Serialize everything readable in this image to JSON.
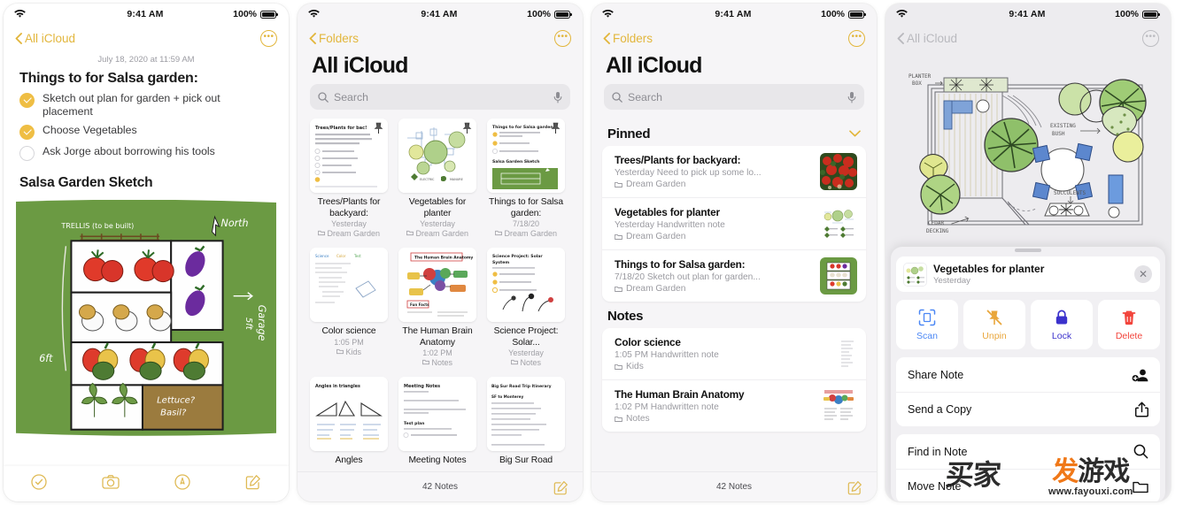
{
  "statusbar": {
    "time": "9:41 AM",
    "battery": "100%",
    "wifi_icon": "wifi-icon"
  },
  "panel1": {
    "nav": {
      "back_label": "All iCloud",
      "more_icon": "more-circle-icon"
    },
    "date": "July 18, 2020 at 11:59 AM",
    "heading": "Things to for Salsa garden:",
    "checklist": [
      {
        "checked": true,
        "text": "Sketch out plan for garden + pick out placement"
      },
      {
        "checked": true,
        "text": "Choose Vegetables"
      },
      {
        "checked": false,
        "text": "Ask Jorge about borrowing his tools"
      }
    ],
    "subheading": "Salsa Garden Sketch",
    "sketch": {
      "trellis_label": "TRELLIS (to be built)",
      "north_label": "North",
      "height_label": "6ft",
      "garage_label": "Garage",
      "garage_dir": "5ft",
      "herb_label_1": "Lettuce?",
      "herb_label_2": "Basil?"
    },
    "toolbar": [
      {
        "name": "checklist-tool",
        "icon": "check-circle-icon"
      },
      {
        "name": "camera-tool",
        "icon": "camera-icon"
      },
      {
        "name": "markup-tool",
        "icon": "markup-pen-icon"
      },
      {
        "name": "compose-tool",
        "icon": "compose-icon"
      }
    ]
  },
  "panel2": {
    "nav": {
      "back_label": "Folders",
      "more_icon": "more-circle-icon"
    },
    "title": "All iCloud",
    "search": {
      "placeholder": "Search",
      "search_icon": "search-icon",
      "mic_icon": "microphone-icon"
    },
    "cards": [
      {
        "title": "Trees/Plants for backyard:",
        "time": "Yesterday",
        "folder": "Dream Garden",
        "pinned": true,
        "thumb": "trees-checklist-thumb",
        "thumb_title": "Trees/Plants for bac!"
      },
      {
        "title": "Vegetables for planter",
        "time": "Yesterday",
        "folder": "Dream Garden",
        "pinned": true,
        "thumb": "planter-sketch-thumb",
        "thumb_title": ""
      },
      {
        "title": "Things to for Salsa garden:",
        "time": "7/18/20",
        "folder": "Dream Garden",
        "pinned": true,
        "thumb": "salsa-garden-thumb",
        "thumb_title": "Things to for Salsa garden:"
      },
      {
        "title": "Color science",
        "time": "1:05 PM",
        "folder": "Kids",
        "pinned": false,
        "thumb": "color-science-thumb",
        "thumb_title": ""
      },
      {
        "title": "The Human Brain Anatomy",
        "time": "1:02 PM",
        "folder": "Notes",
        "pinned": false,
        "thumb": "brain-anatomy-thumb",
        "thumb_title": "The Human Brain Anatomy"
      },
      {
        "title": "Science Project: Solar...",
        "time": "Yesterday",
        "folder": "Notes",
        "pinned": false,
        "thumb": "solar-system-thumb",
        "thumb_title": "Science Project: Solar System"
      },
      {
        "title": "Angles",
        "time": "",
        "folder": "",
        "pinned": false,
        "thumb": "angles-thumb",
        "thumb_title": "Angles in triangles"
      },
      {
        "title": "Meeting Notes",
        "time": "",
        "folder": "",
        "pinned": false,
        "thumb": "meeting-notes-thumb",
        "thumb_title": "Meeting Notes"
      },
      {
        "title": "Big Sur Road",
        "time": "",
        "folder": "",
        "pinned": false,
        "thumb": "big-sur-thumb",
        "thumb_title": "Big Sur Road Trip Itinerary"
      }
    ],
    "footer": {
      "count": "42 Notes",
      "compose_icon": "compose-icon"
    }
  },
  "panel3": {
    "nav": {
      "back_label": "Folders",
      "more_icon": "more-circle-icon"
    },
    "title": "All iCloud",
    "search": {
      "placeholder": "Search",
      "search_icon": "search-icon",
      "mic_icon": "microphone-icon"
    },
    "sections": [
      {
        "header": "Pinned",
        "collapse_icon": "chevron-down-icon",
        "rows": [
          {
            "title": "Trees/Plants for backyard:",
            "sub": "Yesterday  Need to pick up some lo...",
            "folder": "Dream Garden",
            "thumb": "red-flowers-thumb"
          },
          {
            "title": "Vegetables for planter",
            "sub": "Yesterday  Handwritten note",
            "folder": "Dream Garden",
            "thumb": "planter-sketch-thumb"
          },
          {
            "title": "Things to for Salsa garden:",
            "sub": "7/18/20  Sketch out plan for garden...",
            "folder": "Dream Garden",
            "thumb": "salsa-garden-thumb"
          }
        ]
      },
      {
        "header": "Notes",
        "collapse_icon": "",
        "rows": [
          {
            "title": "Color science",
            "sub": "1:05 PM  Handwritten note",
            "folder": "Kids",
            "thumb": "color-science-thumb"
          },
          {
            "title": "The Human Brain Anatomy",
            "sub": "1:02 PM  Handwritten note",
            "folder": "Notes",
            "thumb": "brain-anatomy-thumb"
          }
        ]
      }
    ],
    "footer": {
      "count": "42 Notes",
      "compose_icon": "compose-icon"
    }
  },
  "panel4": {
    "nav": {
      "back_label": "All iCloud",
      "more_icon": "more-circle-icon"
    },
    "sketch_labels": {
      "planter_box": "PLANTER BOX",
      "existing_bush": "EXISTING BUSH",
      "succulents": "SUCCULENTS",
      "cedar_decking": "CEDAR DECKING"
    },
    "sheet": {
      "note_title": "Vegetables for planter",
      "note_sub": "Yesterday",
      "close_icon": "close-icon",
      "thumb": "planter-sketch-thumb",
      "quick_actions": [
        {
          "label": "Scan",
          "icon": "scan-document-icon",
          "color": "#4B87F5"
        },
        {
          "label": "Unpin",
          "icon": "unpin-icon",
          "color": "#E9A63B"
        },
        {
          "label": "Lock",
          "icon": "lock-icon",
          "color": "#3B32CC"
        },
        {
          "label": "Delete",
          "icon": "trash-icon",
          "color": "#F2443B"
        }
      ],
      "menu_group_1": [
        {
          "label": "Share Note",
          "icon": "share-person-icon"
        },
        {
          "label": "Send a Copy",
          "icon": "share-upload-icon"
        }
      ],
      "menu_group_2": [
        {
          "label": "Find in Note",
          "icon": "magnifier-icon"
        },
        {
          "label": "Move Note",
          "icon": "folder-icon"
        }
      ]
    }
  },
  "watermark": {
    "cn_left": "买家",
    "brand_first": "发",
    "brand_rest": "游戏",
    "url": "www.fayouxi.com"
  },
  "colors": {
    "accent_gold": "#E2B63C",
    "check_gold": "#EFBE44",
    "grey_text": "#9A9AA0",
    "bg_grey": "#F6F5F7"
  }
}
